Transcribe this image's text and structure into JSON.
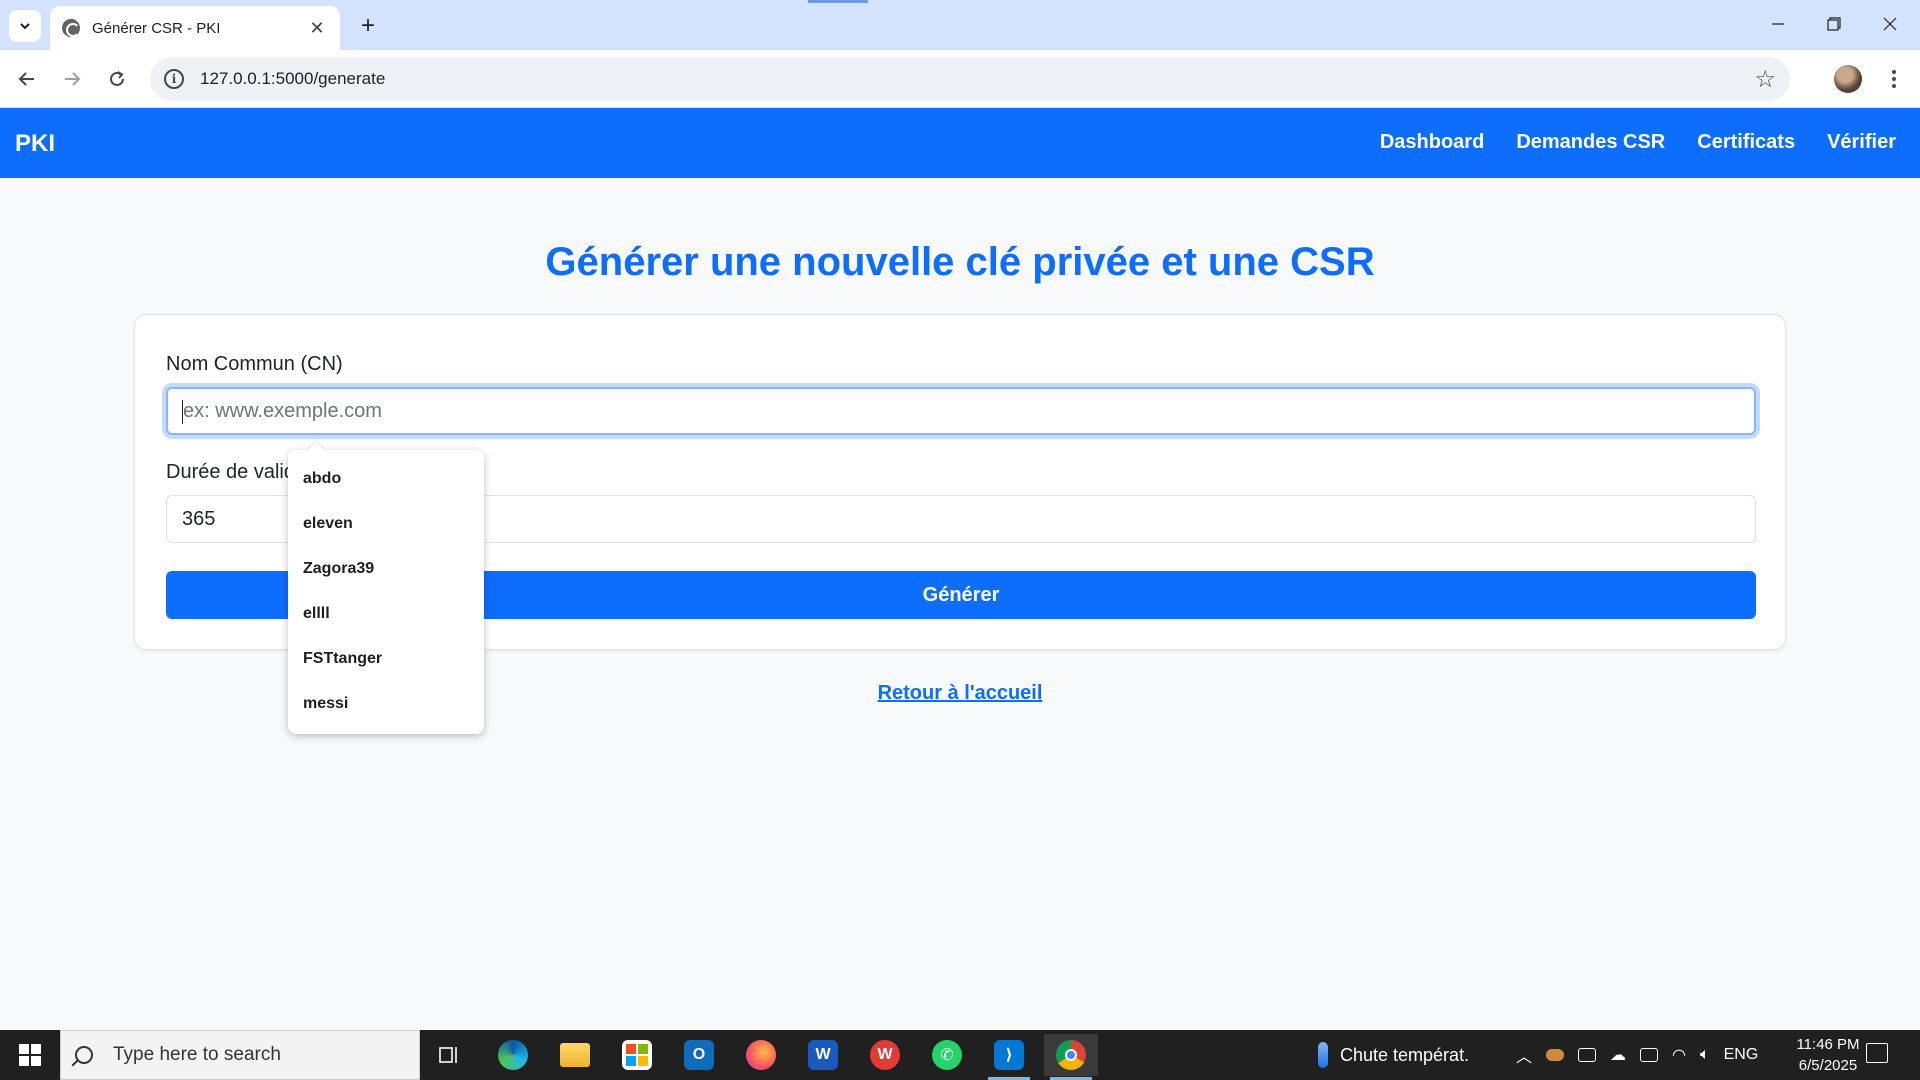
{
  "browser": {
    "tab_title": "Générer CSR - PKI",
    "url": "127.0.0.1:5000/generate"
  },
  "navbar": {
    "brand": "PKI",
    "links": [
      "Dashboard",
      "Demandes CSR",
      "Certificats",
      "Vérifier"
    ]
  },
  "page": {
    "title": "Générer une nouvelle clé privée et une CSR",
    "form": {
      "cn_label": "Nom Commun (CN)",
      "cn_placeholder": "ex: www.exemple.com",
      "cn_value": "",
      "validity_label": "Durée de validité (jours)",
      "validity_value": "365",
      "submit_label": "Générer"
    },
    "back_link": "Retour à l'accueil"
  },
  "autocomplete": {
    "items": [
      "abdo",
      "eleven",
      "Zagora39",
      "ellll",
      "FSTtanger",
      "messi"
    ]
  },
  "taskbar": {
    "search_placeholder": "Type here to search",
    "weather_text": "Chute températ.",
    "language": "ENG",
    "time": "11:46 PM",
    "date": "6/5/2025",
    "apps": [
      "task-view",
      "edge",
      "file-explorer",
      "microsoft-store",
      "outlook",
      "firefox",
      "word",
      "wps-office",
      "whatsapp",
      "vscode",
      "chrome"
    ]
  },
  "colors": {
    "primary": "#0d6efd",
    "tabstrip": "#d3e3fd",
    "page_bg": "#f8f9fa",
    "taskbar": "#202020"
  }
}
